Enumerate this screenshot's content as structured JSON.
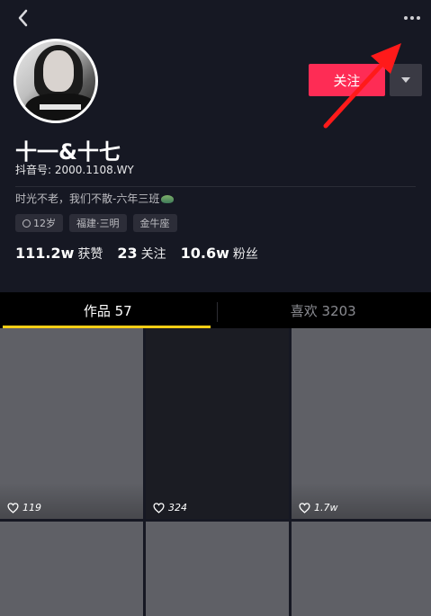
{
  "profile": {
    "nickname": "十一&十七",
    "douyin_id": "抖音号: 2000.1108.WY",
    "bio": "时光不老，我们不散-六年三班",
    "tags": [
      "12岁",
      "福建·三明",
      "金牛座"
    ]
  },
  "actions": {
    "follow_label": "关注"
  },
  "stats": [
    {
      "num": "111.2w",
      "label": "获赞"
    },
    {
      "num": "23",
      "label": "关注"
    },
    {
      "num": "10.6w",
      "label": "粉丝"
    }
  ],
  "tabs": [
    {
      "label": "作品 57",
      "active": true
    },
    {
      "label": "喜欢 3203",
      "active": false
    }
  ],
  "videos": [
    {
      "likes": "119",
      "color": "#5f6066"
    },
    {
      "likes": "324",
      "color": "#1b1c23"
    },
    {
      "likes": "1.7w",
      "color": "#5f6066"
    },
    {
      "likes": "",
      "color": "#5f6066"
    },
    {
      "likes": "",
      "color": "#5f6066"
    },
    {
      "likes": "",
      "color": "#5f6066"
    }
  ],
  "colors": {
    "background": "#161823",
    "follow_button": "#fe2c55",
    "tab_indicator": "#face15",
    "annotation_arrow": "#ff1a1a"
  },
  "icons": [
    "back-arrow-icon",
    "more-dots-icon",
    "dropdown-triangle-icon",
    "gender-female-icon",
    "heart-icon"
  ]
}
